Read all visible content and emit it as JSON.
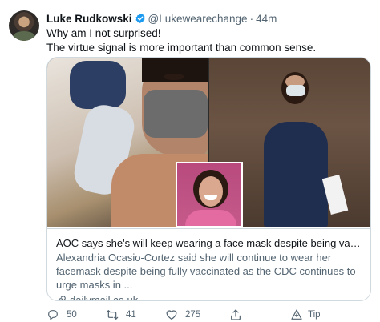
{
  "author": {
    "name": "Luke Rudkowski",
    "handle": "@Lukewearechange",
    "time": "44m",
    "separator": "·"
  },
  "tweet": {
    "line1": "Why am I not surprised!",
    "line2": "The virtue signal is more important than common sense."
  },
  "card": {
    "title": "AOC says she's will keep wearing a face mask despite being vaccinated",
    "description": "Alexandria Ocasio-Cortez said she will continue to wear her facemask despite being fully vaccinated as the CDC continues to urge masks in ...",
    "domain": "dailymail.co.uk"
  },
  "actions": {
    "replies": "50",
    "retweets": "41",
    "likes": "275",
    "tip_label": "Tip"
  },
  "colors": {
    "verified": "#1d9bf0",
    "text_secondary": "#536471",
    "border": "#cfd9de"
  },
  "icons": [
    "verified-icon",
    "link-icon",
    "reply-icon",
    "retweet-icon",
    "like-icon",
    "share-icon",
    "tip-icon"
  ]
}
